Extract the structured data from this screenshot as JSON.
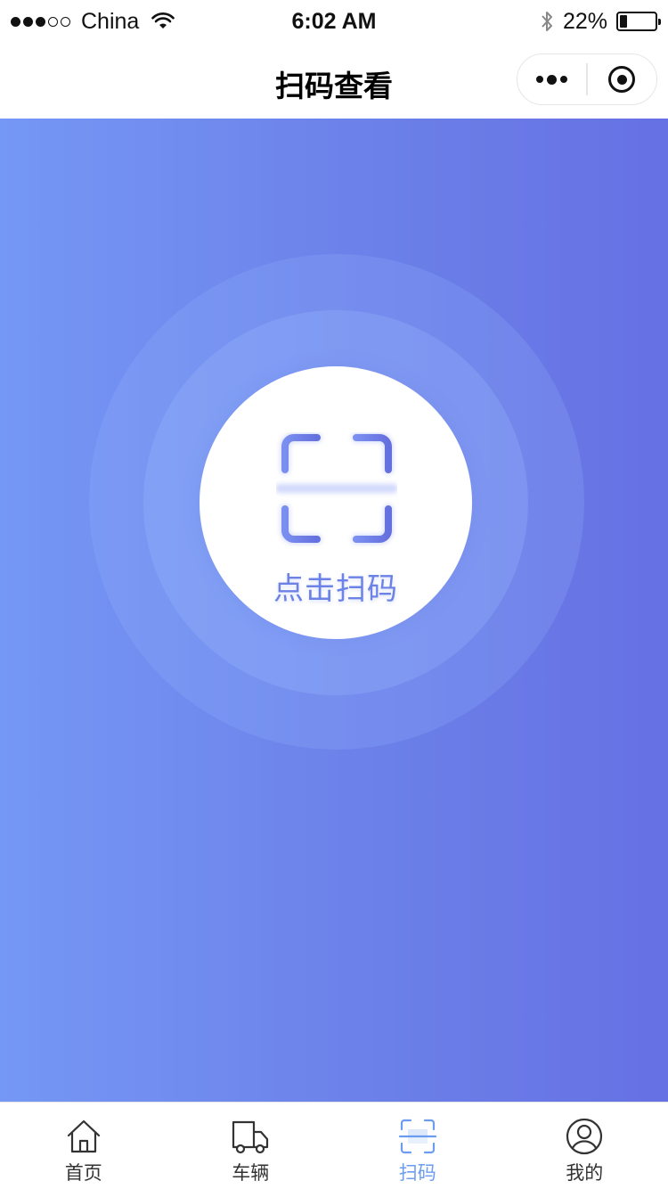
{
  "status_bar": {
    "carrier": "China",
    "time": "6:02 AM",
    "battery_text": "22%",
    "battery_level": 0.22,
    "signal_bars_filled": 3,
    "signal_bars_total": 5
  },
  "nav": {
    "title": "扫码查看"
  },
  "main": {
    "scan_label": "点击扫码"
  },
  "tabs": [
    {
      "label": "首页",
      "icon": "home-icon",
      "active": false
    },
    {
      "label": "车辆",
      "icon": "truck-icon",
      "active": false
    },
    {
      "label": "扫码",
      "icon": "scan-icon",
      "active": true
    },
    {
      "label": "我的",
      "icon": "user-icon",
      "active": false
    }
  ],
  "colors": {
    "gradient_start": "#7597f5",
    "gradient_end": "#6671e3",
    "accent_active": "#6c9cf0",
    "scan_icon": "#6b78e4"
  }
}
